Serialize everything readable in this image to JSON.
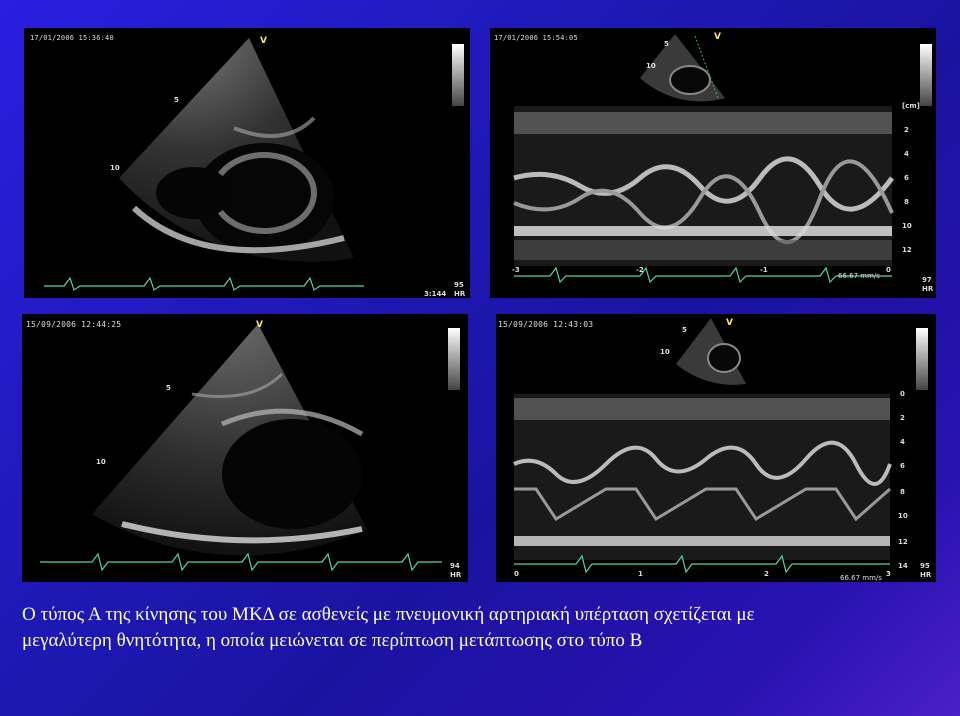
{
  "panels": [
    {
      "timestamp": "17/01/2006 15:36:40",
      "marker": "V",
      "depth_labels": [
        "5",
        "10"
      ],
      "bottom_left_readout": "3:144",
      "hr_value": "95",
      "hr_label": "HR"
    },
    {
      "timestamp": "17/01/2006 15:54:05",
      "marker": "V",
      "depth_labels": [
        "5",
        "10"
      ],
      "scale_unit": "[cm]",
      "scale_values": [
        "2",
        "4",
        "6",
        "8",
        "10",
        "12"
      ],
      "time_ticks": [
        "-3",
        "-2",
        "-1",
        "0"
      ],
      "sweep_speed": "66.67 mm/s",
      "hr_value": "97",
      "hr_label": "HR"
    },
    {
      "timestamp": "15/09/2006 12:44:25",
      "marker": "V",
      "depth_labels": [
        "5",
        "10"
      ],
      "hr_value": "94",
      "hr_label": "HR"
    },
    {
      "timestamp": "15/09/2006 12:43:03",
      "marker": "V",
      "depth_labels": [
        "5",
        "10"
      ],
      "scale_values": [
        "0",
        "2",
        "4",
        "6",
        "8",
        "10",
        "12",
        "14"
      ],
      "time_ticks": [
        "0",
        "1",
        "2",
        "3"
      ],
      "sweep_speed": "66.67 mm/s",
      "hr_value": "95",
      "hr_label": "HR"
    }
  ],
  "caption": {
    "line1": "Ο τύπος Α της κίνησης του ΜΚΔ σε ασθενείς με πνευμονική αρτηριακή υπέρταση σχετίζεται με",
    "line2": "μεγαλύτερη θνητότητα, η οποία μειώνεται σε περίπτωση μετάπτωσης στο τύπο Β"
  },
  "colors": {
    "ecg_trace": "#4fd6b0",
    "marker": "#ffe66a",
    "background_blue": "#1f1ab8"
  }
}
